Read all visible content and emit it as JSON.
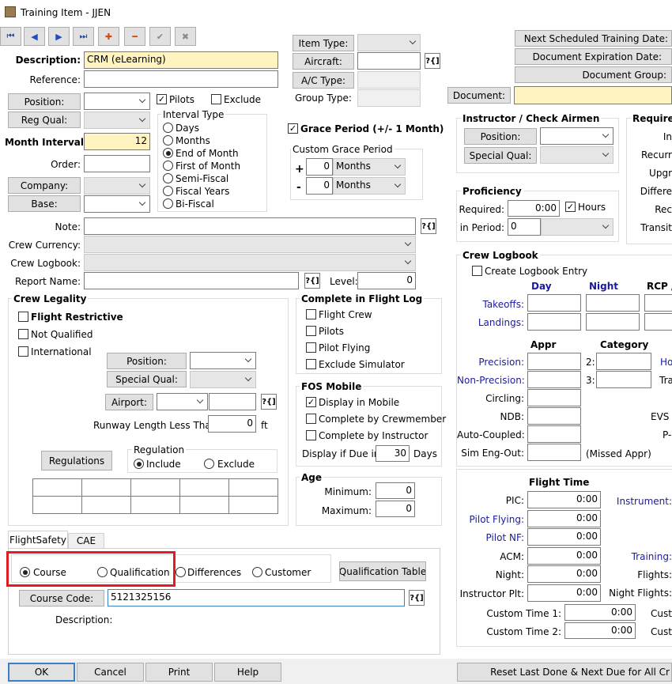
{
  "window": {
    "title": "Training Item - JJEN"
  },
  "toolbar": {
    "first": "⏮",
    "prev": "◀",
    "next": "▶",
    "last": "⏭",
    "add": "✚",
    "remove": "━",
    "confirm": "✔",
    "cancel": "✖"
  },
  "lookup_glyph": "?{]",
  "main": {
    "description_label": "Description:",
    "description_value": "CRM (eLearning)",
    "reference_label": "Reference:",
    "position_btn": "Position:",
    "pilots": "Pilots",
    "exclude": "Exclude",
    "reg_qual_btn": "Reg Qual:",
    "month_interval_label": "Month Interval:",
    "month_interval_value": "12",
    "order_label": "Order:",
    "company_btn": "Company:",
    "base_btn": "Base:",
    "interval_type": {
      "title": "Interval Type",
      "options": [
        "Days",
        "Months",
        "End of Month",
        "First of Month",
        "Semi-Fiscal",
        "Fiscal Years",
        "Bi-Fiscal"
      ],
      "selected": "End of Month"
    },
    "item_type_btn": "Item Type:",
    "aircraft_btn": "Aircraft:",
    "ac_type_btn": "A/C Type:",
    "group_type_label": "Group Type:",
    "grace_period": "Grace Period (+/- 1 Month)",
    "custom_grace": {
      "title": "Custom Grace Period",
      "plus": "+",
      "minus": "-",
      "plus_value": "0",
      "plus_unit": "Months",
      "minus_value": "0",
      "minus_unit": "Months"
    },
    "note_label": "Note:",
    "crew_currency_label": "Crew Currency:",
    "crew_logbook_label": "Crew Logbook:",
    "report_name_label": "Report Name:",
    "level_label": "Level:",
    "level_value": "0"
  },
  "right_top": {
    "next_training": "Next Scheduled Training Date:",
    "doc_expiration": "Document Expiration Date:",
    "doc_group": "Document Group:",
    "document_btn": "Document:"
  },
  "crew_legality": {
    "title": "Crew Legality",
    "flight_restrictive": "Flight Restrictive",
    "not_qualified": "Not Qualified",
    "international": "International",
    "position_btn": "Position:",
    "special_qual_btn": "Special Qual:",
    "airport_btn": "Airport:",
    "runway_label": "Runway Length Less Than:",
    "runway_value": "0",
    "runway_unit": "ft",
    "regulations_btn": "Regulations",
    "regulation_title": "Regulation",
    "include": "Include",
    "exclude": "Exclude"
  },
  "complete_flight_log": {
    "title": "Complete in Flight Log",
    "items": [
      "Flight Crew",
      "Pilots",
      "Pilot Flying",
      "Exclude Simulator"
    ]
  },
  "fos_mobile": {
    "title": "FOS Mobile",
    "display_mobile": "Display in Mobile",
    "by_crewmember": "Complete by Crewmember",
    "by_instructor": "Complete by Instructor",
    "display_due_label": "Display if Due in:",
    "display_due_value": "30",
    "display_due_unit": "Days"
  },
  "age": {
    "title": "Age",
    "minimum_label": "Minimum:",
    "minimum_value": "0",
    "maximum_label": "Maximum:",
    "maximum_value": "0"
  },
  "tabs": {
    "flightsafety": "FlightSafety",
    "cae": "CAE"
  },
  "flightsafety": {
    "course": "Course",
    "qualification": "Qualification",
    "differences": "Differences",
    "customer": "Customer",
    "qual_table_btn": "Qualification Table",
    "course_code_btn": "Course Code:",
    "course_code_value": "5121325156",
    "description_label": "Description:"
  },
  "instructor": {
    "title": "Instructor / Check Airmen",
    "position_btn": "Position:",
    "special_qual_btn": "Special Qual:"
  },
  "required": {
    "title": "Required",
    "labels": [
      "In",
      "Recurr",
      "Upgr",
      "Differe",
      "Rec",
      "Transit"
    ]
  },
  "proficiency": {
    "title": "Proficiency",
    "required_label": "Required:",
    "required_value": "0:00",
    "hours": "Hours",
    "in_period_label": "in Period:",
    "in_period_value": "0"
  },
  "crew_logbook": {
    "title": "Crew Logbook",
    "create_entry": "Create Logbook Entry",
    "day": "Day",
    "night": "Night",
    "rcp": "RCP /",
    "takeoffs": "Takeoffs:",
    "landings": "Landings:",
    "appr": "Appr",
    "category": "Category",
    "precision": "Precision:",
    "non_precision": "Non-Precision:",
    "circling": "Circling:",
    "ndb": "NDB:",
    "auto_coupled": "Auto-Coupled:",
    "sim_eng_out": "Sim Eng-Out:",
    "missed_appr": "(Missed Appr)",
    "cat2": "2:",
    "cat3": "3:",
    "ho": "Ho",
    "tra": "Tra",
    "evs": "EVS /",
    "p": "P-"
  },
  "flight_time": {
    "title": "Flight Time",
    "rows": [
      {
        "label": "PIC:",
        "value": "0:00",
        "blue": false
      },
      {
        "label": "Pilot Flying:",
        "value": "0:00",
        "blue": true
      },
      {
        "label": "Pilot NF:",
        "value": "0:00",
        "blue": true
      },
      {
        "label": "ACM:",
        "value": "0:00",
        "blue": false
      },
      {
        "label": "Night:",
        "value": "0:00",
        "blue": false
      },
      {
        "label": "Instructor Plt:",
        "value": "0:00",
        "blue": false
      }
    ],
    "right_labels": [
      "Instrument:",
      "Training:",
      "Flights:",
      "Night Flights:"
    ],
    "custom1_label": "Custom Time 1:",
    "custom1_value": "0:00",
    "custom2_label": "Custom Time 2:",
    "custom2_value": "0:00",
    "custom_right": "Custo"
  },
  "bottom": {
    "ok": "OK",
    "cancel": "Cancel",
    "print": "Print",
    "help": "Help",
    "reset": "Reset Last Done & Next Due for All Cr"
  },
  "colors": {
    "highlight": "#fff4c0",
    "annotation": "#e01b24",
    "link_blue": "#1a1a9e"
  }
}
